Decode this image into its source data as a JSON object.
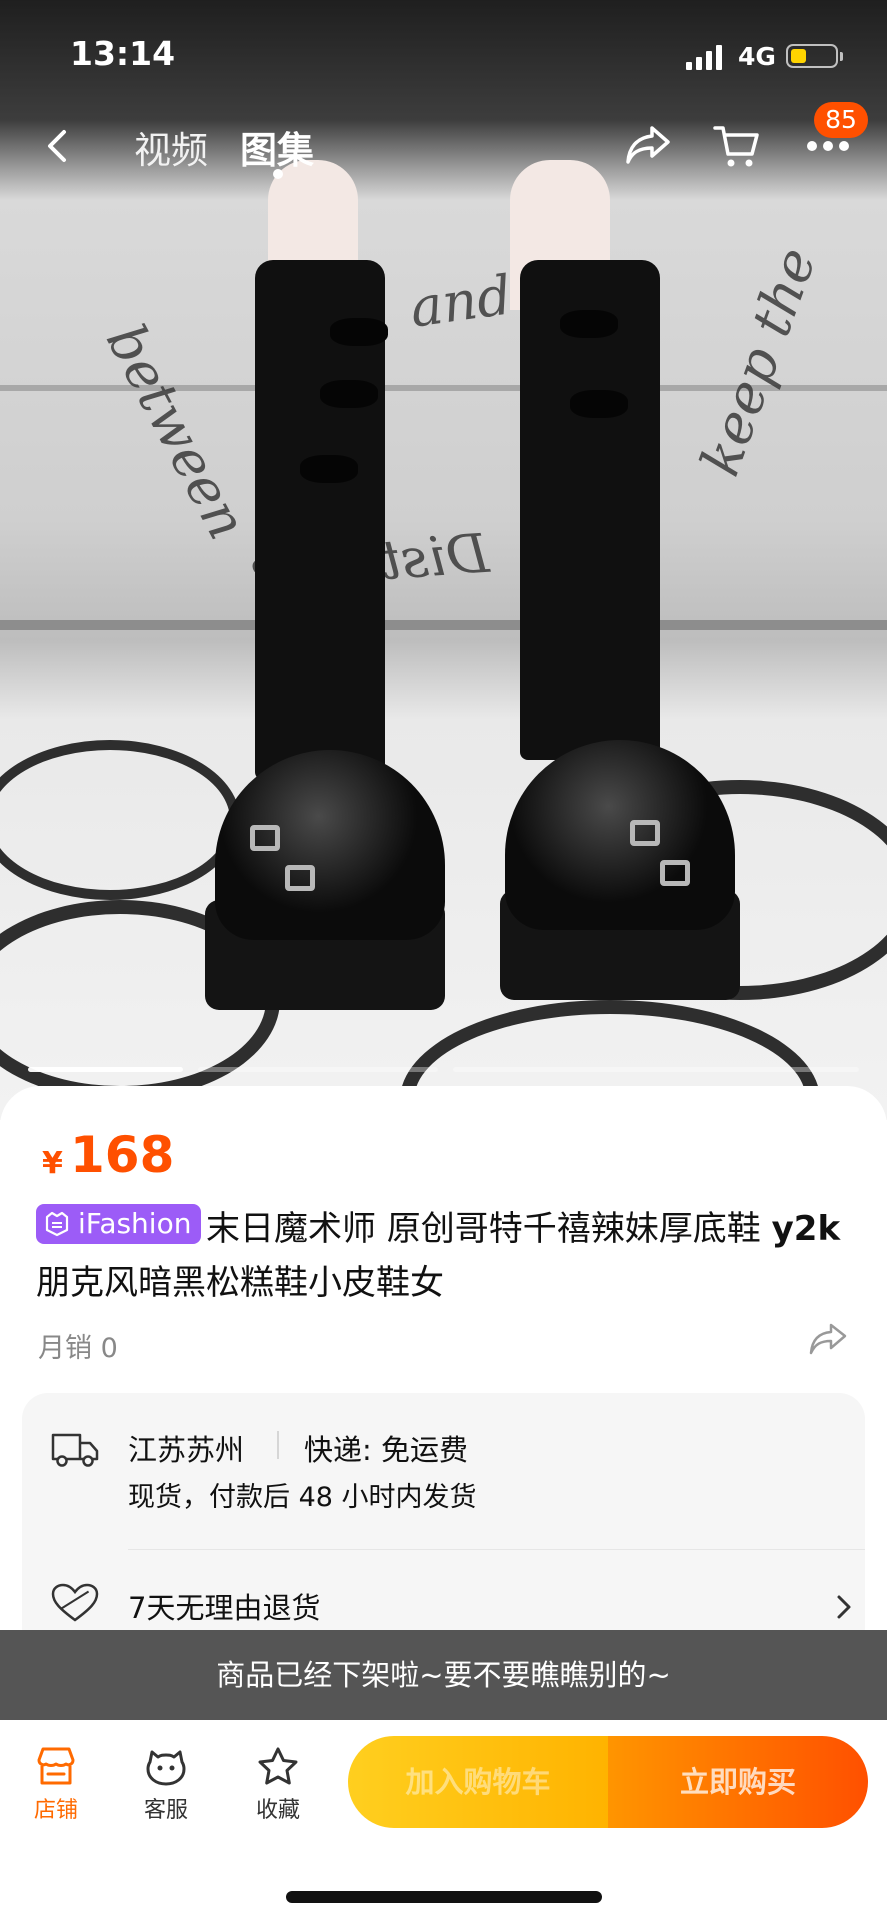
{
  "status_bar": {
    "time": "13:14",
    "network": "4G",
    "battery_level": 0.35,
    "battery_color": "#ffd400"
  },
  "nav": {
    "tabs": [
      {
        "label": "视频",
        "active": false
      },
      {
        "label": "图集",
        "active": true
      }
    ],
    "cart_badge": "85",
    "icons": [
      "back-arrow-icon",
      "share-icon",
      "cart-icon",
      "more-icon"
    ]
  },
  "gallery": {
    "photo_wall_text": "and keep the Distance between",
    "indicator": {
      "count": 3,
      "active_index": 0
    }
  },
  "product": {
    "price_symbol": "¥",
    "price": "168",
    "brand_tag": "iFashion",
    "title_part1": "末日魔术师 原创哥特千禧辣妹厚底鞋",
    "title_bold": "y2k",
    "title_part2": "朋克风暗黑松糕鞋小皮鞋女",
    "monthly_sales": "月销 0",
    "accent_color": "#ff5000",
    "tag_color": "#9c5cf7"
  },
  "service": {
    "origin": "江苏苏州",
    "shipping": "快递: 免运费",
    "ship_note": "现货，付款后 48 小时内发货",
    "returns": "7天无理由退货"
  },
  "notice": "商品已经下架啦~要不要瞧瞧别的~",
  "bottom_bar": {
    "shop": "店铺",
    "service": "客服",
    "favorite": "收藏",
    "add_to_cart": "加入购物车",
    "buy_now": "立即购买"
  }
}
